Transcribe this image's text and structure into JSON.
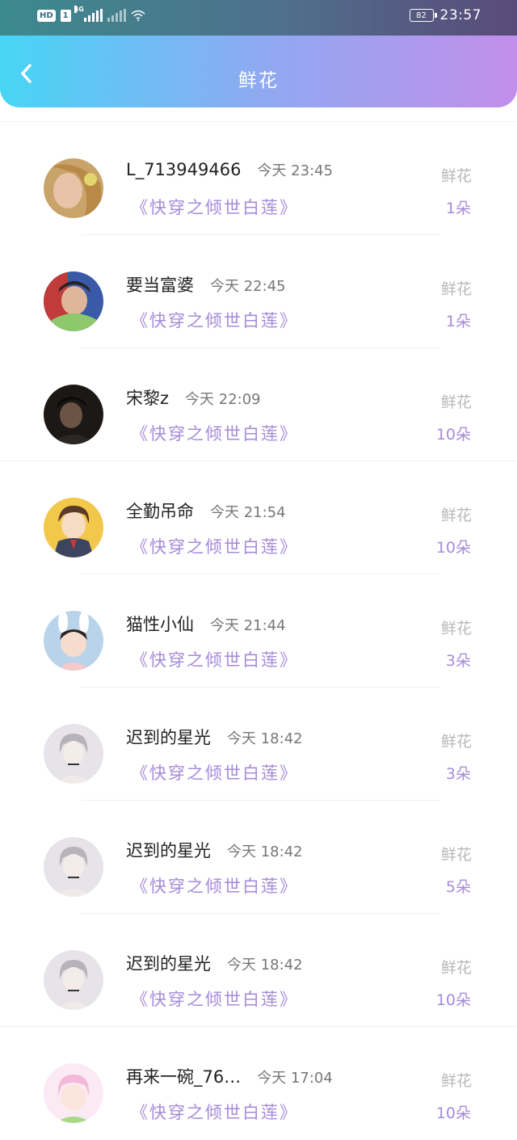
{
  "status_bar": {
    "hd": "HD",
    "sim": "1",
    "network": "4G",
    "battery": "82",
    "time": "23:57"
  },
  "header": {
    "title": "鲜花",
    "back_icon": "chevron-left-icon"
  },
  "colors": {
    "accent": "#a68bd9",
    "header_start": "#47d5f4",
    "header_end": "#c28eeb"
  },
  "records": [
    {
      "name": "L_713949466",
      "time": "今天 23:45",
      "book": "《快穿之倾世白莲》",
      "label": "鲜花",
      "count": "1朵"
    },
    {
      "name": "要当富婆",
      "time": "今天 22:45",
      "book": "《快穿之倾世白莲》",
      "label": "鲜花",
      "count": "1朵"
    },
    {
      "name": "宋黎z",
      "time": "今天 22:09",
      "book": "《快穿之倾世白莲》",
      "label": "鲜花",
      "count": "10朵"
    },
    {
      "name": "全勤吊命",
      "time": "今天 21:54",
      "book": "《快穿之倾世白莲》",
      "label": "鲜花",
      "count": "10朵"
    },
    {
      "name": "猫性小仙",
      "time": "今天 21:44",
      "book": "《快穿之倾世白莲》",
      "label": "鲜花",
      "count": "3朵"
    },
    {
      "name": "迟到的星光",
      "time": "今天 18:42",
      "book": "《快穿之倾世白莲》",
      "label": "鲜花",
      "count": "3朵"
    },
    {
      "name": "迟到的星光",
      "time": "今天 18:42",
      "book": "《快穿之倾世白莲》",
      "label": "鲜花",
      "count": "5朵"
    },
    {
      "name": "迟到的星光",
      "time": "今天 18:42",
      "book": "《快穿之倾世白莲》",
      "label": "鲜花",
      "count": "10朵"
    },
    {
      "name": "再来一碗_76…",
      "time": "今天 17:04",
      "book": "《快穿之倾世白莲》",
      "label": "鲜花",
      "count": "10朵"
    }
  ]
}
